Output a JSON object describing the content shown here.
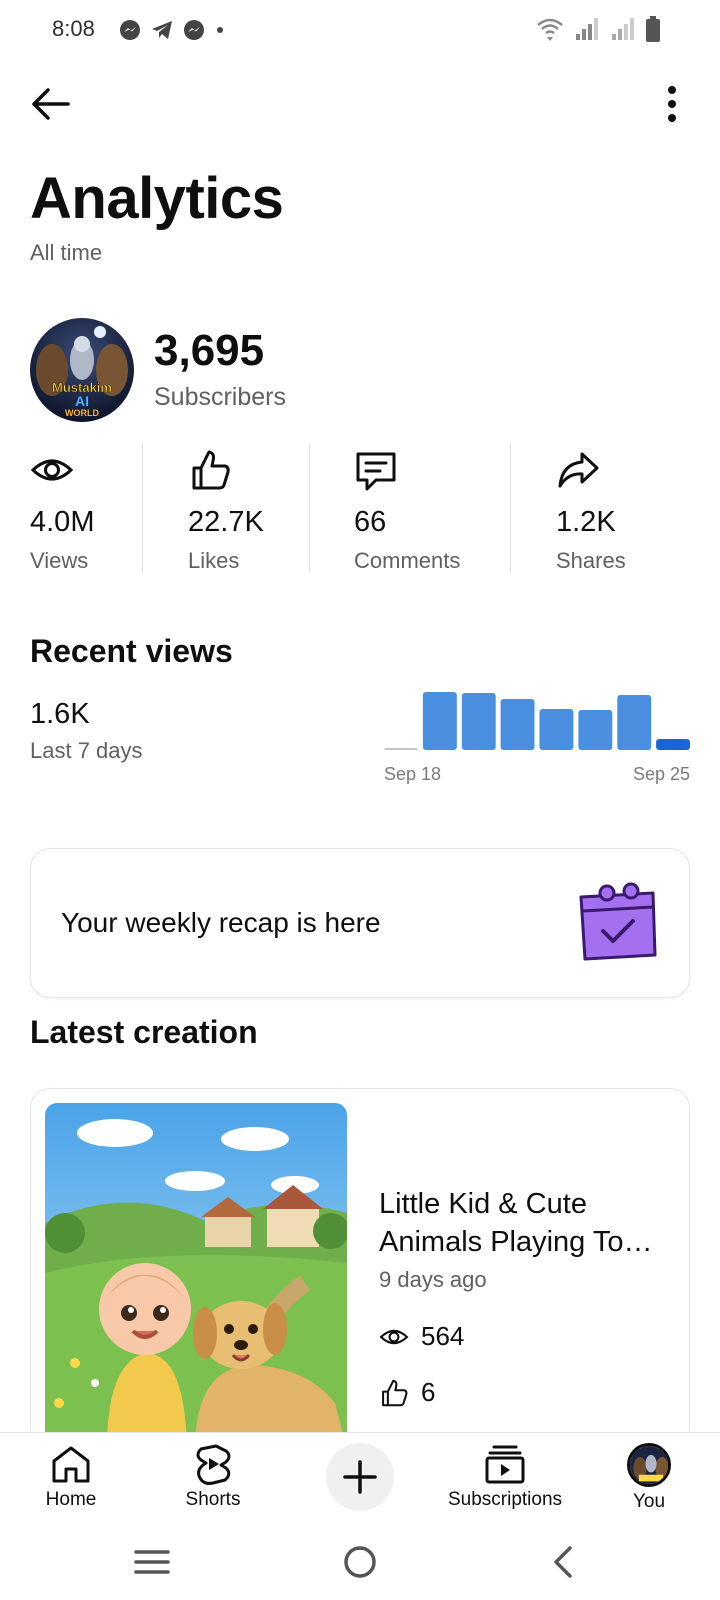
{
  "status_bar": {
    "time": "8:08"
  },
  "header": {
    "title": "Analytics",
    "subtitle": "All time"
  },
  "channel": {
    "subscriber_count": "3,695",
    "subscriber_label": "Subscribers",
    "avatar_text": [
      "Mustakim",
      "AI",
      "WORLD"
    ]
  },
  "stats": [
    {
      "icon": "eye-icon",
      "value": "4.0M",
      "label": "Views"
    },
    {
      "icon": "thumbs-up-icon",
      "value": "22.7K",
      "label": "Likes"
    },
    {
      "icon": "comment-icon",
      "value": "66",
      "label": "Comments"
    },
    {
      "icon": "share-icon",
      "value": "1.2K",
      "label": "Shares"
    }
  ],
  "recent_views": {
    "title": "Recent views",
    "value": "1.6K",
    "period_label": "Last 7 days",
    "chart_data": {
      "type": "bar",
      "x_start_label": "Sep 18",
      "x_end_label": "Sep 25",
      "values": [
        2,
        290,
        285,
        255,
        205,
        200,
        275,
        55
      ],
      "colors": {
        "bar": "#4a8ee0",
        "current": "#1a65d6",
        "zero": "#c6c6c6"
      }
    }
  },
  "recap": {
    "text": "Your weekly recap is here",
    "icon": "calendar-check-icon"
  },
  "latest_creation": {
    "title": "Latest creation",
    "video_title": "Little Kid & Cute Animals Playing To…",
    "age": "9 days ago",
    "views": "564",
    "likes": "6"
  },
  "bottom_nav": {
    "home": "Home",
    "shorts": "Shorts",
    "subscriptions": "Subscriptions",
    "you": "You"
  }
}
